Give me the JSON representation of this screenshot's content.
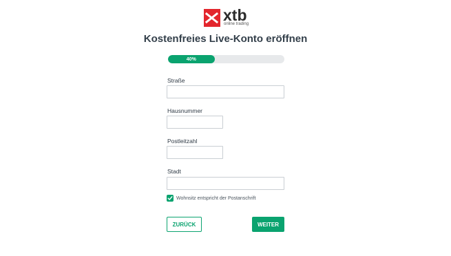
{
  "logo": {
    "wordmark": "xtb",
    "tagline": "online trading",
    "brand_color": "#e3262d"
  },
  "page": {
    "title": "Kostenfreies Live-Konto eröffnen"
  },
  "progress": {
    "label": "40%",
    "value": 0.4,
    "color": "#0aa36f"
  },
  "form": {
    "street": {
      "label": "Straße",
      "value": ""
    },
    "house_number": {
      "label": "Hausnummer",
      "value": ""
    },
    "postcode": {
      "label": "Postleitzahl",
      "value": ""
    },
    "city": {
      "label": "Stadt",
      "value": ""
    },
    "residence_checkbox": {
      "label": "Wohnsitz entspricht der Postanschrift",
      "checked": true
    }
  },
  "buttons": {
    "back_label": "ZURÜCK",
    "next_label": "WEITER"
  }
}
